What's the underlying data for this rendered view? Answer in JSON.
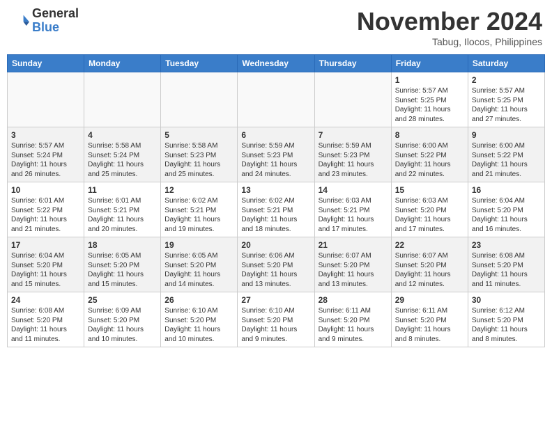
{
  "header": {
    "logo_general": "General",
    "logo_blue": "Blue",
    "title": "November 2024",
    "location": "Tabug, Ilocos, Philippines"
  },
  "calendar": {
    "columns": [
      "Sunday",
      "Monday",
      "Tuesday",
      "Wednesday",
      "Thursday",
      "Friday",
      "Saturday"
    ],
    "weeks": [
      [
        {
          "day": "",
          "info": ""
        },
        {
          "day": "",
          "info": ""
        },
        {
          "day": "",
          "info": ""
        },
        {
          "day": "",
          "info": ""
        },
        {
          "day": "",
          "info": ""
        },
        {
          "day": "1",
          "info": "Sunrise: 5:57 AM\nSunset: 5:25 PM\nDaylight: 11 hours\nand 28 minutes."
        },
        {
          "day": "2",
          "info": "Sunrise: 5:57 AM\nSunset: 5:25 PM\nDaylight: 11 hours\nand 27 minutes."
        }
      ],
      [
        {
          "day": "3",
          "info": "Sunrise: 5:57 AM\nSunset: 5:24 PM\nDaylight: 11 hours\nand 26 minutes."
        },
        {
          "day": "4",
          "info": "Sunrise: 5:58 AM\nSunset: 5:24 PM\nDaylight: 11 hours\nand 25 minutes."
        },
        {
          "day": "5",
          "info": "Sunrise: 5:58 AM\nSunset: 5:23 PM\nDaylight: 11 hours\nand 25 minutes."
        },
        {
          "day": "6",
          "info": "Sunrise: 5:59 AM\nSunset: 5:23 PM\nDaylight: 11 hours\nand 24 minutes."
        },
        {
          "day": "7",
          "info": "Sunrise: 5:59 AM\nSunset: 5:23 PM\nDaylight: 11 hours\nand 23 minutes."
        },
        {
          "day": "8",
          "info": "Sunrise: 6:00 AM\nSunset: 5:22 PM\nDaylight: 11 hours\nand 22 minutes."
        },
        {
          "day": "9",
          "info": "Sunrise: 6:00 AM\nSunset: 5:22 PM\nDaylight: 11 hours\nand 21 minutes."
        }
      ],
      [
        {
          "day": "10",
          "info": "Sunrise: 6:01 AM\nSunset: 5:22 PM\nDaylight: 11 hours\nand 21 minutes."
        },
        {
          "day": "11",
          "info": "Sunrise: 6:01 AM\nSunset: 5:21 PM\nDaylight: 11 hours\nand 20 minutes."
        },
        {
          "day": "12",
          "info": "Sunrise: 6:02 AM\nSunset: 5:21 PM\nDaylight: 11 hours\nand 19 minutes."
        },
        {
          "day": "13",
          "info": "Sunrise: 6:02 AM\nSunset: 5:21 PM\nDaylight: 11 hours\nand 18 minutes."
        },
        {
          "day": "14",
          "info": "Sunrise: 6:03 AM\nSunset: 5:21 PM\nDaylight: 11 hours\nand 17 minutes."
        },
        {
          "day": "15",
          "info": "Sunrise: 6:03 AM\nSunset: 5:20 PM\nDaylight: 11 hours\nand 17 minutes."
        },
        {
          "day": "16",
          "info": "Sunrise: 6:04 AM\nSunset: 5:20 PM\nDaylight: 11 hours\nand 16 minutes."
        }
      ],
      [
        {
          "day": "17",
          "info": "Sunrise: 6:04 AM\nSunset: 5:20 PM\nDaylight: 11 hours\nand 15 minutes."
        },
        {
          "day": "18",
          "info": "Sunrise: 6:05 AM\nSunset: 5:20 PM\nDaylight: 11 hours\nand 15 minutes."
        },
        {
          "day": "19",
          "info": "Sunrise: 6:05 AM\nSunset: 5:20 PM\nDaylight: 11 hours\nand 14 minutes."
        },
        {
          "day": "20",
          "info": "Sunrise: 6:06 AM\nSunset: 5:20 PM\nDaylight: 11 hours\nand 13 minutes."
        },
        {
          "day": "21",
          "info": "Sunrise: 6:07 AM\nSunset: 5:20 PM\nDaylight: 11 hours\nand 13 minutes."
        },
        {
          "day": "22",
          "info": "Sunrise: 6:07 AM\nSunset: 5:20 PM\nDaylight: 11 hours\nand 12 minutes."
        },
        {
          "day": "23",
          "info": "Sunrise: 6:08 AM\nSunset: 5:20 PM\nDaylight: 11 hours\nand 11 minutes."
        }
      ],
      [
        {
          "day": "24",
          "info": "Sunrise: 6:08 AM\nSunset: 5:20 PM\nDaylight: 11 hours\nand 11 minutes."
        },
        {
          "day": "25",
          "info": "Sunrise: 6:09 AM\nSunset: 5:20 PM\nDaylight: 11 hours\nand 10 minutes."
        },
        {
          "day": "26",
          "info": "Sunrise: 6:10 AM\nSunset: 5:20 PM\nDaylight: 11 hours\nand 10 minutes."
        },
        {
          "day": "27",
          "info": "Sunrise: 6:10 AM\nSunset: 5:20 PM\nDaylight: 11 hours\nand 9 minutes."
        },
        {
          "day": "28",
          "info": "Sunrise: 6:11 AM\nSunset: 5:20 PM\nDaylight: 11 hours\nand 9 minutes."
        },
        {
          "day": "29",
          "info": "Sunrise: 6:11 AM\nSunset: 5:20 PM\nDaylight: 11 hours\nand 8 minutes."
        },
        {
          "day": "30",
          "info": "Sunrise: 6:12 AM\nSunset: 5:20 PM\nDaylight: 11 hours\nand 8 minutes."
        }
      ]
    ]
  }
}
